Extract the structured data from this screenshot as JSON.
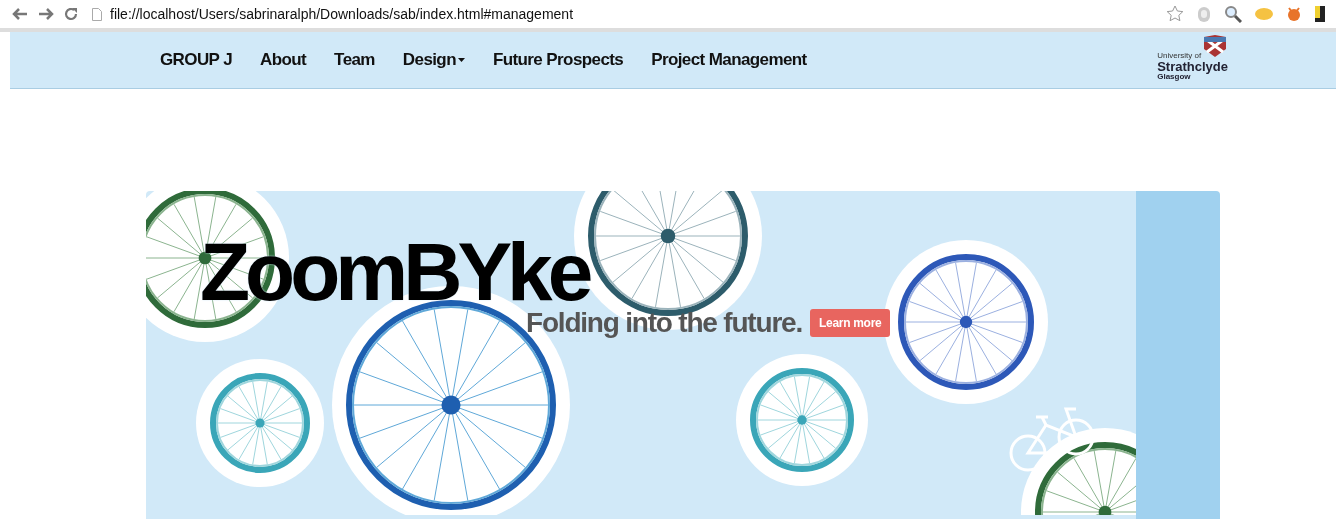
{
  "browser": {
    "url": "file://localhost/Users/sabrinaralph/Downloads/sab/index.html#management"
  },
  "navbar": {
    "items": [
      {
        "label": "GROUP J",
        "has_menu": false
      },
      {
        "label": "About",
        "has_menu": false
      },
      {
        "label": "Team",
        "has_menu": false
      },
      {
        "label": "Design",
        "has_menu": true
      },
      {
        "label": "Future Prospects",
        "has_menu": false
      },
      {
        "label": "Project Management",
        "has_menu": false
      }
    ],
    "logo": {
      "line_1": "University of",
      "line_2": "Strathclyde",
      "line_3": "Glasgow"
    }
  },
  "hero": {
    "title": "ZoomBYke",
    "tagline": "Folding into the future.",
    "button": "Learn more"
  }
}
